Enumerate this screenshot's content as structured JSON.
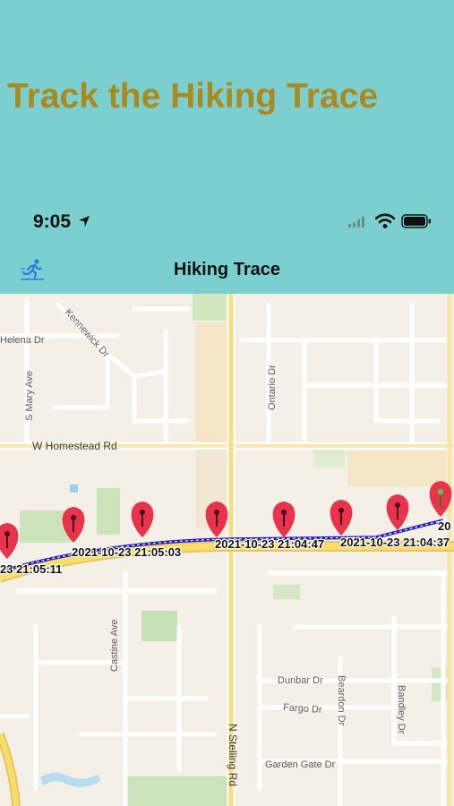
{
  "promo": {
    "title": "Track the Hiking Trace"
  },
  "status_bar": {
    "time": "9:05"
  },
  "nav_bar": {
    "title": "Hiking Trace",
    "left_icon": "running-person-icon"
  },
  "map": {
    "streets": [
      "Helena Dr",
      "Kennewick Dr",
      "S Mary Ave",
      "Ontario Dr",
      "W Homestead Rd",
      "Castine Ave",
      "N Stelling Rd",
      "Dunbar Dr",
      "Fargo Dr",
      "Beardon Dr",
      "Bandley Dr",
      "Garden Gate Dr"
    ],
    "timestamps": [
      "23 21:05:11",
      "2021-10-23 21:05:03",
      "2021-10-23 21:04:47",
      "2021-10-23 21:04:37",
      "20"
    ],
    "pin_colors": {
      "waypoint": "#e8334a",
      "start": "#5ec24a"
    },
    "trace_color": "#1c18c8"
  }
}
